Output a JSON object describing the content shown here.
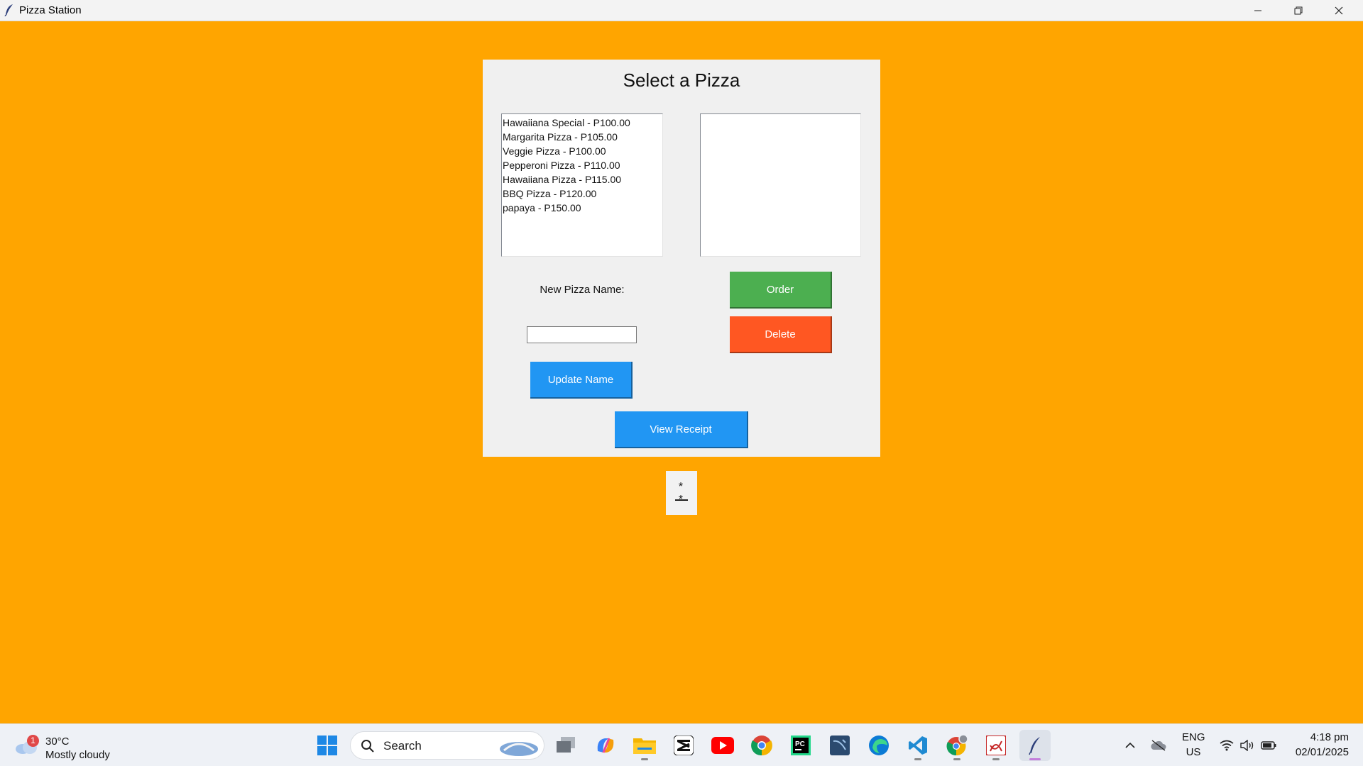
{
  "window": {
    "title": "Pizza Station",
    "app_icon": "feather-icon",
    "minimize_icon": "minimize-icon",
    "maximize_icon": "restore-icon",
    "close_icon": "close-icon"
  },
  "colors": {
    "background": "#FFA500",
    "order_button": "#4CAF50",
    "delete_button": "#FF5722",
    "blue_button": "#2196F3"
  },
  "panel": {
    "title": "Select a Pizza",
    "menu_items": [
      "Hawaiiana Special - P100.00",
      "Margarita Pizza - P105.00",
      "Veggie Pizza - P100.00",
      "Pepperoni Pizza - P110.00",
      "Hawaiiana Pizza - P115.00",
      "BBQ Pizza - P120.00",
      "papaya - P150.00"
    ],
    "order_items": [],
    "new_name_label": "New Pizza Name:",
    "new_name_value": "",
    "order_label": "Order",
    "delete_label": "Delete",
    "update_label": "Update Name",
    "receipt_label": "View Receipt"
  },
  "face": {
    "eyes": "* *",
    "mouth": "—"
  },
  "taskbar": {
    "weather_badge": "1",
    "weather_temp": "30°C",
    "weather_desc": "Mostly cloudy",
    "search_label": "Search",
    "apps": [
      "start-icon",
      "task-view-icon",
      "copilot-icon",
      "file-explorer-icon",
      "capcut-icon",
      "youtube-icon",
      "chrome-icon",
      "pycharm-icon",
      "mysql-workbench-icon",
      "edge-icon",
      "vscode-icon",
      "chrome-profile-icon",
      "pdf-app-icon",
      "pizza-station-icon"
    ],
    "lang_top": "ENG",
    "lang_bottom": "US",
    "time": "4:18 pm",
    "date": "02/01/2025"
  }
}
